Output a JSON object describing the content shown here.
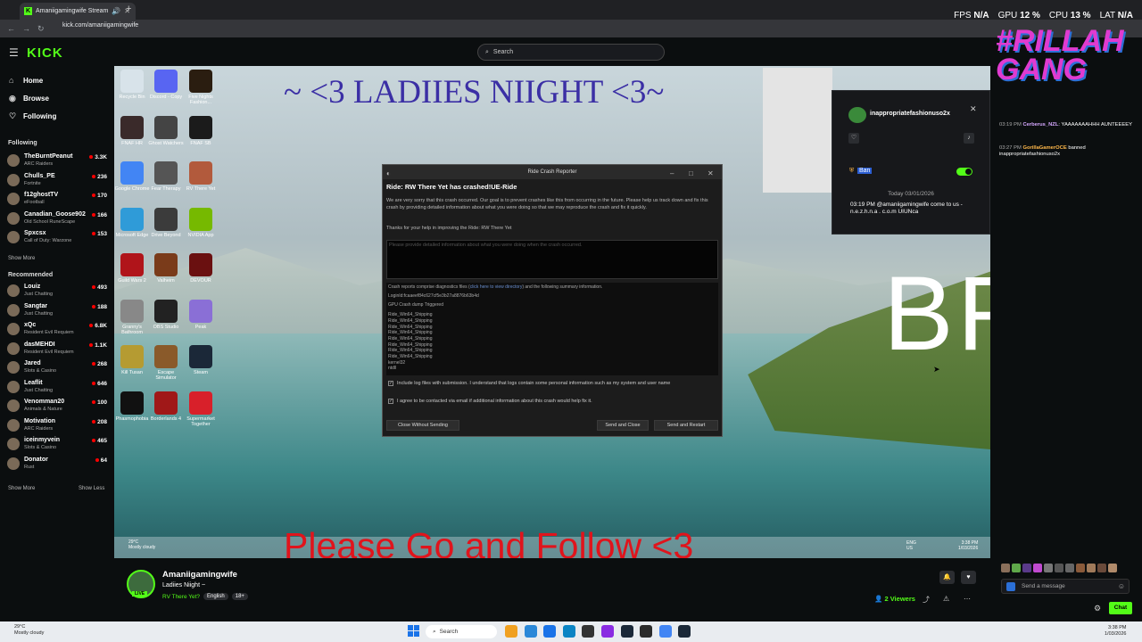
{
  "browser": {
    "tab_title": "Amaniigamingwife Stream",
    "url": "kick.com/amaniigamingwife"
  },
  "perf": {
    "fps_label": "FPS",
    "fps_value": "N/A",
    "gpu_label": "GPU",
    "gpu_value": "12 %",
    "cpu_label": "CPU",
    "cpu_value": "13 %",
    "lat_label": "LAT",
    "lat_value": "N/A"
  },
  "header": {
    "logo": "KICK",
    "search_placeholder": "Search"
  },
  "sidebar": {
    "nav": [
      {
        "label": "Home",
        "icon": "home-icon"
      },
      {
        "label": "Browse",
        "icon": "compass-icon"
      },
      {
        "label": "Following",
        "icon": "heart-icon"
      }
    ],
    "following_heading": "Following",
    "following": [
      {
        "name": "TheBurntPeanut",
        "category": "ARC Raiders",
        "viewers": "3.3K"
      },
      {
        "name": "Chulls_PE",
        "category": "Fortnite",
        "viewers": "236"
      },
      {
        "name": "f12ghostTV",
        "category": "eFootball",
        "viewers": "170"
      },
      {
        "name": "Canadian_Goose902",
        "category": "Old School RuneScape",
        "viewers": "166"
      },
      {
        "name": "Spxcsx",
        "category": "Call of Duty: Warzone",
        "viewers": "153"
      }
    ],
    "show_more_1": "Show More",
    "recommended_heading": "Recommended",
    "recommended": [
      {
        "name": "Louiz",
        "category": "Just Chatting",
        "viewers": "493"
      },
      {
        "name": "Sangtar",
        "category": "Just Chatting",
        "viewers": "188"
      },
      {
        "name": "xQc",
        "category": "Resident Evil Requiem",
        "viewers": "6.8K"
      },
      {
        "name": "dasMEHDI",
        "category": "Resident Evil Requiem",
        "viewers": "1.1K"
      },
      {
        "name": "Jared",
        "category": "Slots & Casino",
        "viewers": "268"
      },
      {
        "name": "Leaflit",
        "category": "Just Chatting",
        "viewers": "646"
      },
      {
        "name": "Venomman20",
        "category": "Animals & Nature",
        "viewers": "100"
      },
      {
        "name": "Motivation",
        "category": "ARC Raiders",
        "viewers": "208"
      },
      {
        "name": "iceinmyvein",
        "category": "Slots & Casino",
        "viewers": "465"
      },
      {
        "name": "Donator",
        "category": "Rust",
        "viewers": "64"
      }
    ],
    "show_more_2": "Show More",
    "show_less": "Show Less"
  },
  "stream_overlay": {
    "title": "~ <3 LADIIES NIIGHT <3~",
    "brb": "BRB",
    "follow_banner": "Please Go and Follow <3"
  },
  "desktop_icons": [
    {
      "label": "Recycle Bin",
      "color": "#d8e3ea"
    },
    {
      "label": "Discord - Copy",
      "color": "#5865f2"
    },
    {
      "label": "Five Nights Fashion...",
      "color": "#2a1d10"
    },
    {
      "label": "FNAF HR",
      "color": "#3a2a2a"
    },
    {
      "label": "Ghost Watchers",
      "color": "#444"
    },
    {
      "label": "FNAF SB",
      "color": "#1b1b1b"
    },
    {
      "label": "Google Chrome",
      "color": "#4285f4"
    },
    {
      "label": "Fear Therapy",
      "color": "#555"
    },
    {
      "label": "RV There Yet",
      "color": "#b25a3c"
    },
    {
      "label": "Microsoft Edge",
      "color": "#2f9bd8"
    },
    {
      "label": "Drive Beyond",
      "color": "#3b3b3b"
    },
    {
      "label": "NVIDIA App",
      "color": "#76b900"
    },
    {
      "label": "Guild Wars 2",
      "color": "#b0141a"
    },
    {
      "label": "Valheim",
      "color": "#7a3b1a"
    },
    {
      "label": "DEVOUR",
      "color": "#6a1010"
    },
    {
      "label": "Granny's Bathroom",
      "color": "#888"
    },
    {
      "label": "OBS Studio",
      "color": "#222"
    },
    {
      "label": "Peak",
      "color": "#8a6fd6"
    },
    {
      "label": "Kill Tusan",
      "color": "#b59b32"
    },
    {
      "label": "Escape Simulator",
      "color": "#8a5a2a"
    },
    {
      "label": "Steam",
      "color": "#1b2838"
    },
    {
      "label": "Phasmophobia",
      "color": "#111"
    },
    {
      "label": "Borderlands 4",
      "color": "#a01818"
    },
    {
      "label": "Supermarket Together",
      "color": "#d8202a"
    }
  ],
  "crash_dialog": {
    "window_title": "Ride Crash Reporter",
    "heading": "Ride: RW There Yet has crashed!UE-Ride",
    "body": "We are very sorry that this crash occurred. Our goal is to prevent crashes like this from occurring in the future. Please help us track down and fix this crash by providing detailed information about what you were doing so that we may reproduce the crash and fix it quickly.",
    "thanks": "Thanks for your help in improving the Ride: RW There Yet",
    "input_placeholder": "Please provide detailed information about what you were doing when the crash occurred.",
    "info_intro_pre": "Crash reports comprise diagnostics files (",
    "info_link": "click here to view directory",
    "info_intro_post": ") and the following summary information.",
    "log_id": "LoginId:fcaaeef84c627cf5e3b27a8876b63b4d",
    "gpu_line": "GPU Crash dump Triggered",
    "stack": [
      "Ride_Win64_Shipping",
      "Ride_Win64_Shipping",
      "Ride_Win64_Shipping",
      "Ride_Win64_Shipping",
      "Ride_Win64_Shipping",
      "Ride_Win64_Shipping",
      "Ride_Win64_Shipping",
      "Ride_Win64_Shipping",
      "kernel32",
      "ntdll"
    ],
    "check1": "Include log files with submission. I understand that logs contain some personal information such as my system and user name",
    "check2": "I agree to be contacted via email if additional information about this crash would help fix it.",
    "btn_close_without": "Close Without Sending",
    "btn_send_close": "Send and Close",
    "btn_send_restart": "Send and Restart"
  },
  "mod_popup": {
    "username": "inappropriatefashionuso2x",
    "ban_label": "Ban",
    "date": "Today 03/01/2026",
    "message": "03:19 PM @amaniigamingwife come to us - n.e.z.h.n.a . c.o.m UIUNca"
  },
  "chat": {
    "overlay_text": "#RILLAH GANG",
    "lines": [
      {
        "time": "03:19 PM",
        "user": "Cerberus_NZL",
        "text": ": YAAAAAAAHHH AUNTEEEEY",
        "color": "#d6a8ff"
      },
      {
        "time": "03:27 PM",
        "user": "GorillaGamerOCE",
        "text": " banned inappropriatefashionuso2x",
        "color": "#ffb84a"
      }
    ],
    "input_placeholder": "Send a message",
    "chat_button": "Chat"
  },
  "stream_info": {
    "streamer": "Amaniigamingwife",
    "title": "Ladiies Niight ~",
    "category": "RV There Yet?",
    "tag1": "English",
    "tag2": "18+",
    "live": "LIVE",
    "viewers": "2 Viewers"
  },
  "inner_taskbar": {
    "weather_temp": "29°C",
    "weather_desc": "Mostly cloudy",
    "lang1": "ENG",
    "lang2": "US",
    "time": "3:38 PM",
    "date": "1/03/2026"
  },
  "taskbar": {
    "weather_temp": "29°C",
    "weather_desc": "Mostly cloudy",
    "search": "Search",
    "time": "3:38 PM",
    "date": "1/03/2026"
  }
}
